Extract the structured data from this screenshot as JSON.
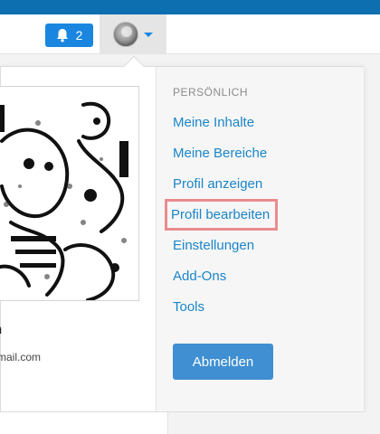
{
  "header": {
    "notifications": {
      "count": "2",
      "icon": "bell-icon"
    },
    "user_menu": {
      "avatar": "avatar",
      "caret_icon": "chevron-down-icon"
    }
  },
  "dropdown": {
    "left": {
      "name": "n",
      "email": "mail.com"
    },
    "right": {
      "section_heading": "PERSÖNLICH",
      "items": [
        {
          "label": "Meine Inhalte"
        },
        {
          "label": "Meine Bereiche"
        },
        {
          "label": "Profil anzeigen"
        },
        {
          "label": "Profil bearbeiten",
          "highlighted": true
        },
        {
          "label": "Einstellungen"
        },
        {
          "label": "Add-Ons"
        },
        {
          "label": "Tools"
        }
      ],
      "logout_label": "Abmelden"
    }
  },
  "colors": {
    "brand_blue": "#0d6fb0",
    "link_blue": "#1a86c9",
    "button_blue": "#3f8fd2",
    "notification_blue": "#1a86e0",
    "highlight_outline": "#ea8b8e"
  }
}
